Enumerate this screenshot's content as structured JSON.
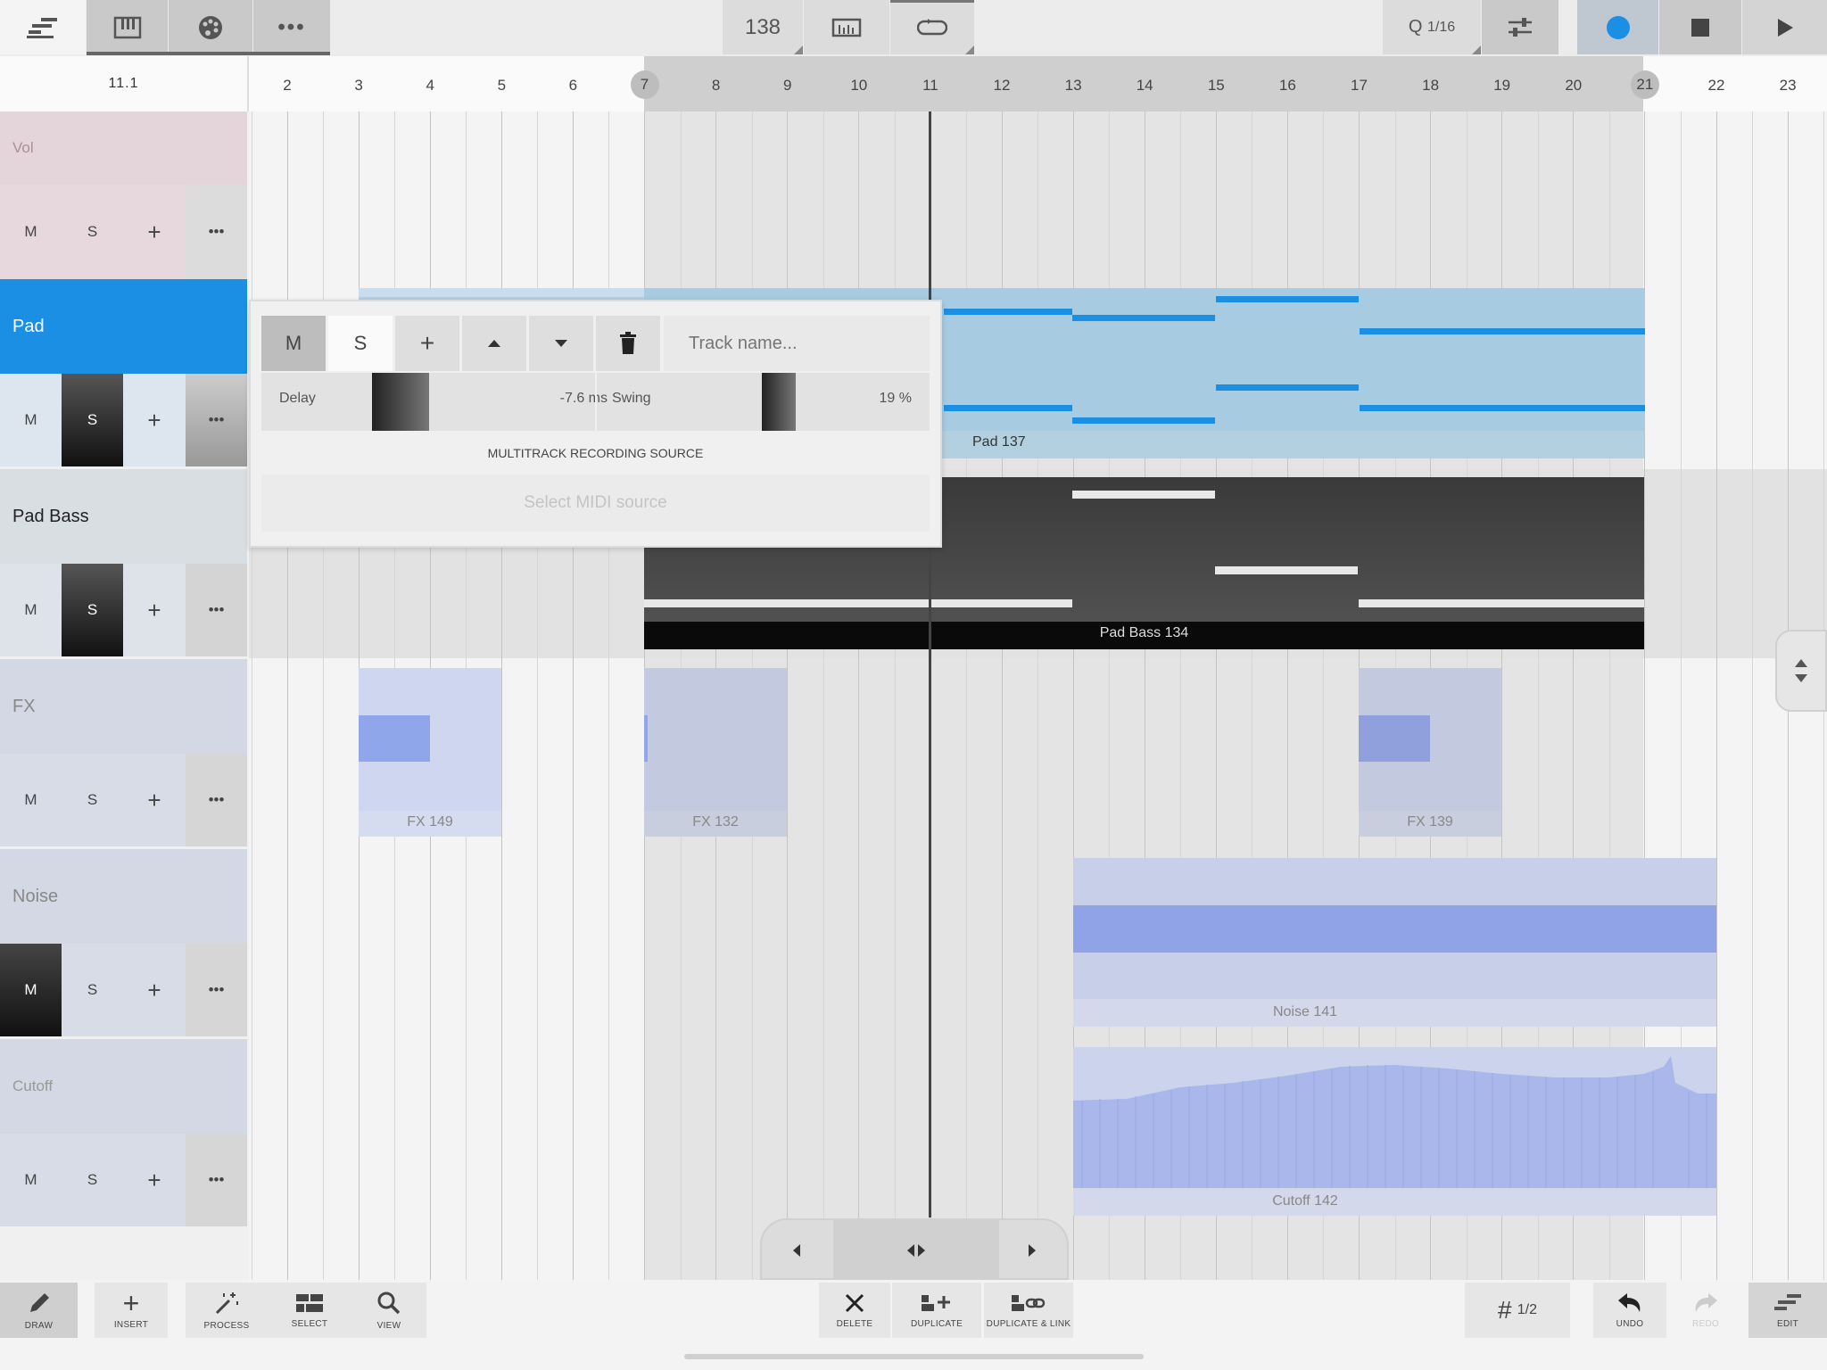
{
  "toolbar": {
    "tempo": "138",
    "quantize_prefix": "Q",
    "quantize_value": "1/16",
    "accent_record": "#1a8fe3"
  },
  "ruler": {
    "position": "11.1",
    "bars": [
      "2",
      "3",
      "4",
      "5",
      "6",
      "7",
      "8",
      "9",
      "10",
      "11",
      "12",
      "13",
      "14",
      "15",
      "16",
      "17",
      "18",
      "19",
      "20",
      "21",
      "22",
      "23"
    ],
    "loop_start": "7",
    "loop_end": "21"
  },
  "tracks": [
    {
      "name": "Vol",
      "mute": "M",
      "solo": "S",
      "add": "+",
      "more": "•••"
    },
    {
      "name": "Pad",
      "mute": "M",
      "solo": "S",
      "add": "+",
      "more": "•••"
    },
    {
      "name": "Pad Bass",
      "mute": "M",
      "solo": "S",
      "add": "+",
      "more": "•••"
    },
    {
      "name": "FX",
      "mute": "M",
      "solo": "S",
      "add": "+",
      "more": "•••"
    },
    {
      "name": "Noise",
      "mute": "M",
      "solo": "S",
      "add": "+",
      "more": "•••"
    },
    {
      "name": "Cutoff",
      "mute": "M",
      "solo": "S",
      "add": "+",
      "more": "•••"
    }
  ],
  "clips": {
    "pad": "Pad  137",
    "pad_bass": "Pad Bass  134",
    "fx1": "FX  149",
    "fx2": "FX  132",
    "fx3": "FX  139",
    "noise": "Noise  141",
    "cutoff": "Cutoff  142"
  },
  "popup": {
    "mute": "M",
    "solo": "S",
    "add": "+",
    "track_name_placeholder": "Track name...",
    "delay_label": "Delay",
    "delay_value": "-7.6 ms",
    "swing_label": "Swing",
    "swing_value": "19 %",
    "section_title": "MULTITRACK RECORDING SOURCE",
    "midi_source": "Select MIDI source"
  },
  "bottombar": {
    "draw": "DRAW",
    "insert": "INSERT",
    "process": "PROCESS",
    "select": "SELECT",
    "view": "VIEW",
    "delete": "DELETE",
    "duplicate": "DUPLICATE",
    "duplicate_link": "DUPLICATE & LINK",
    "grid_value": "1/2",
    "undo": "UNDO",
    "redo": "REDO",
    "edit": "EDIT"
  }
}
